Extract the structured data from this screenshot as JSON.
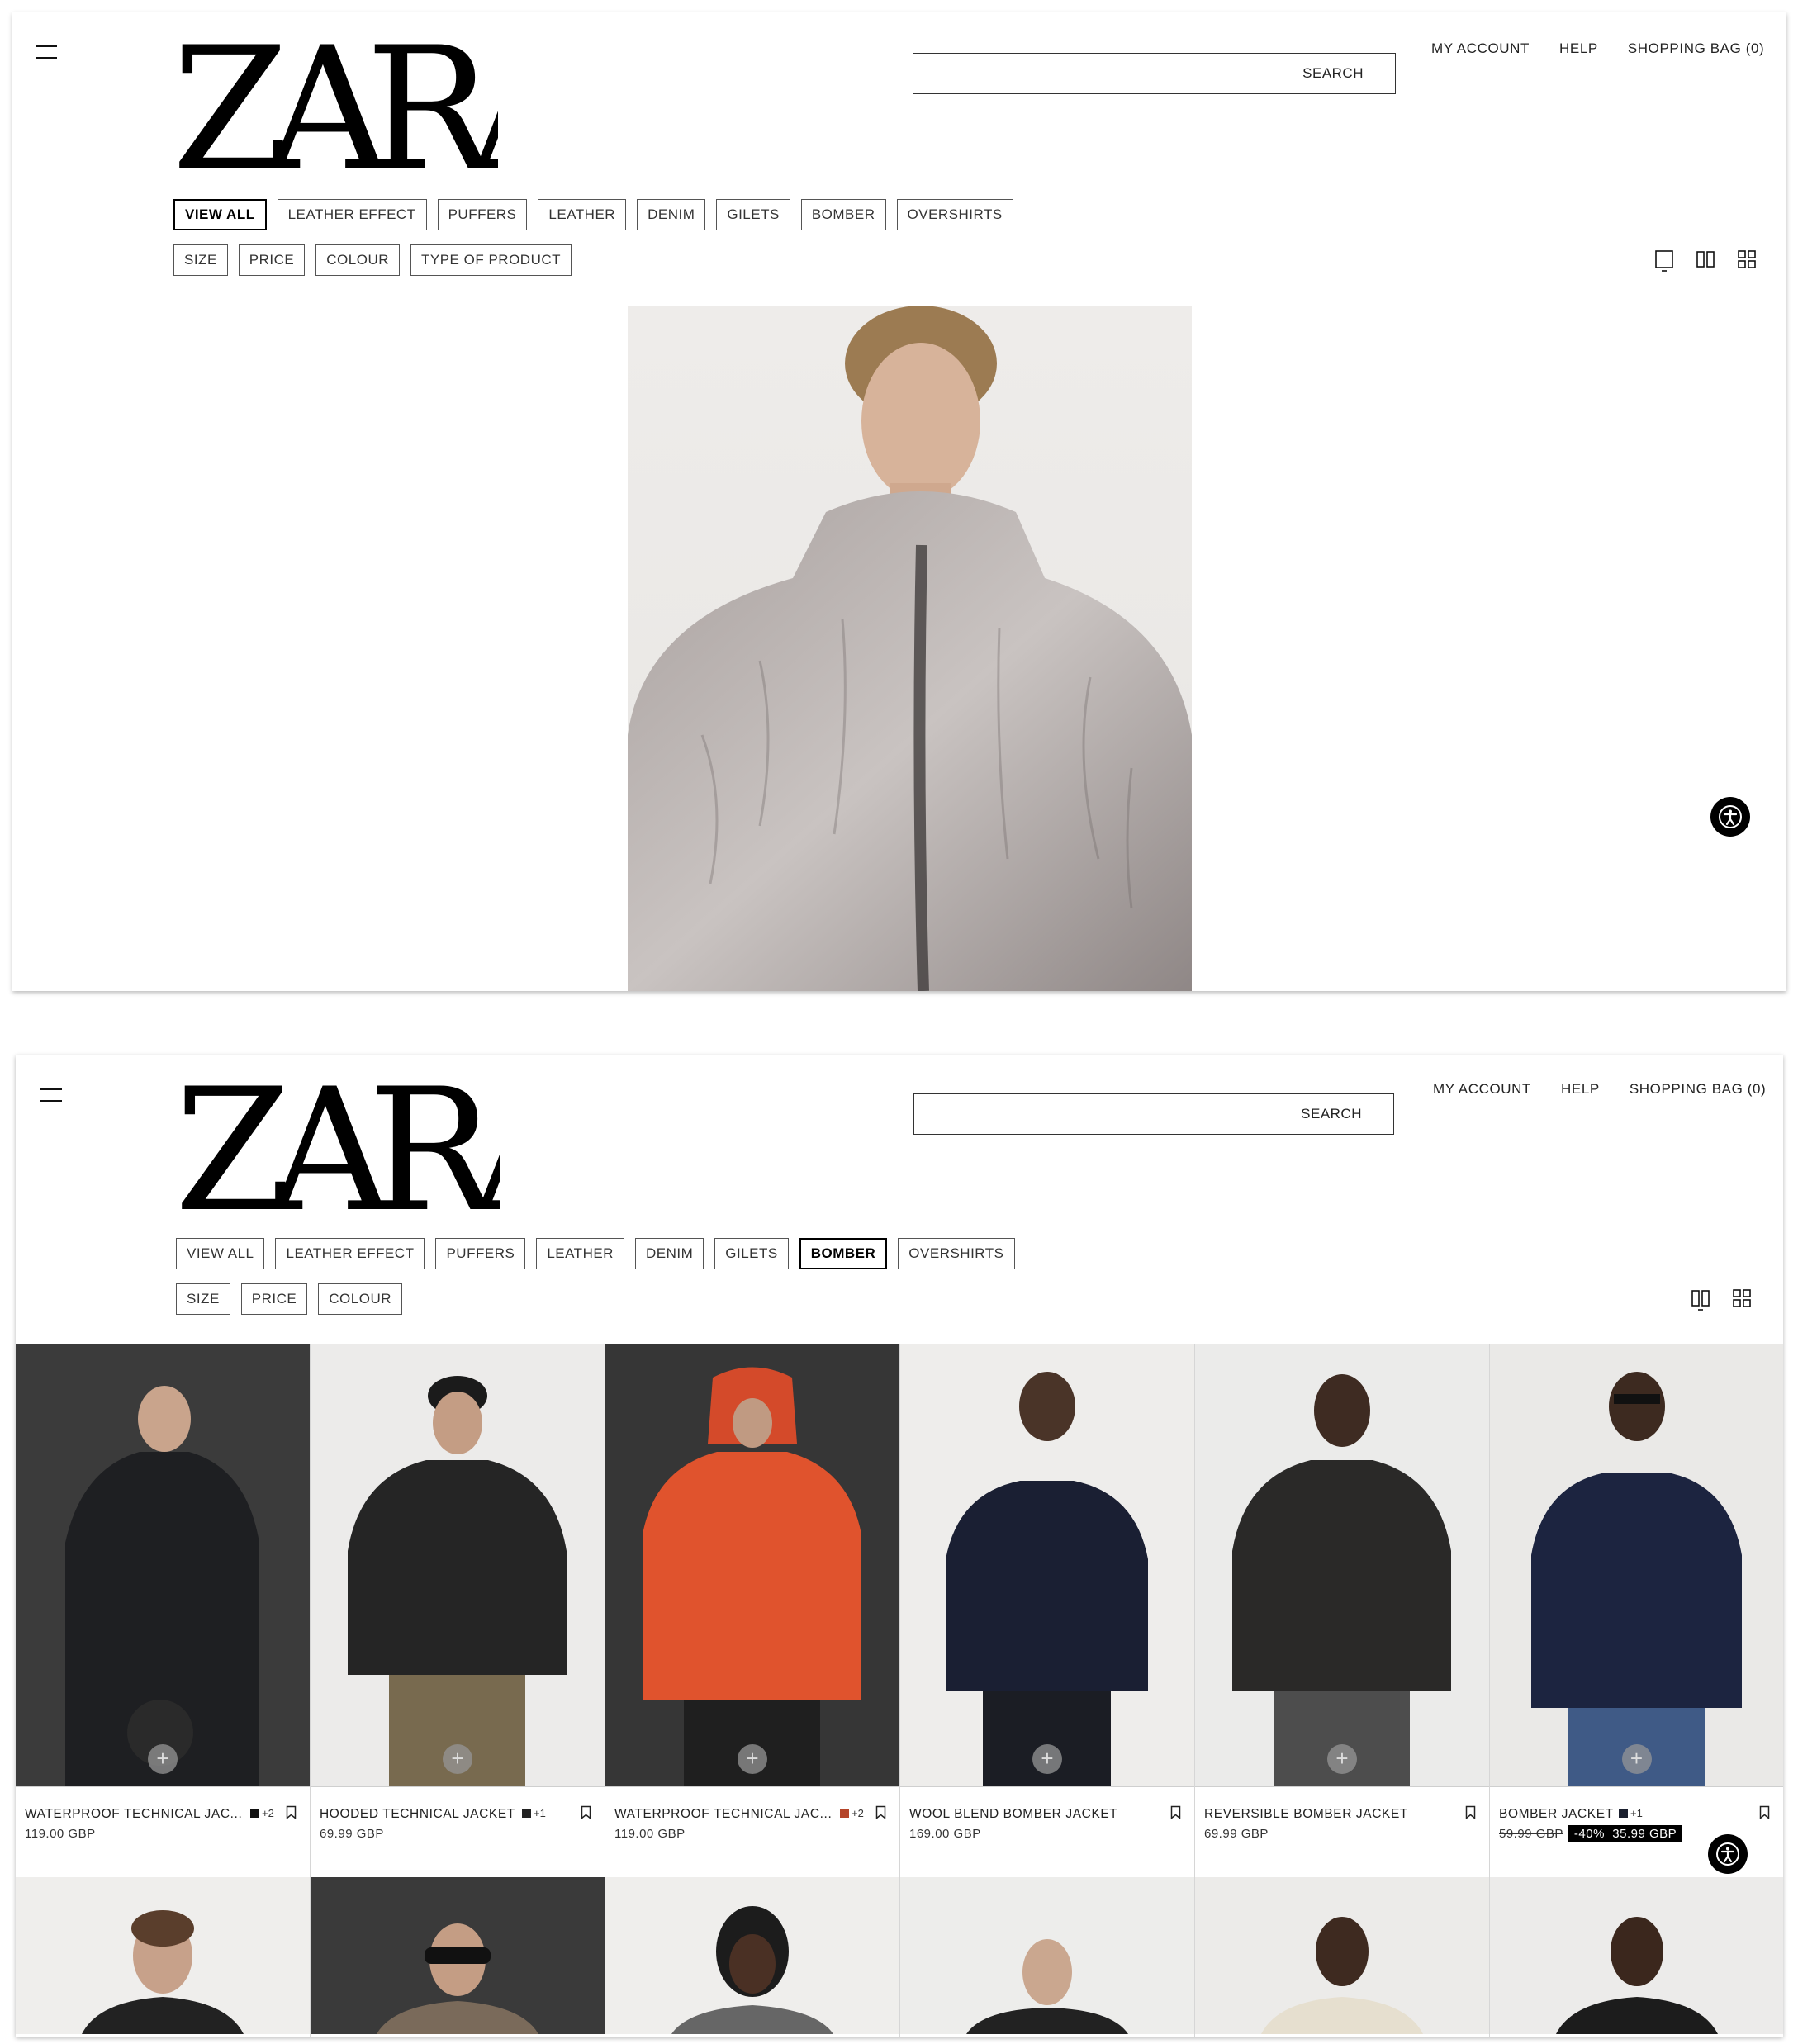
{
  "brand": {
    "logo_text": "ZARA"
  },
  "header": {
    "search_label": "SEARCH",
    "nav": [
      "MY ACCOUNT",
      "HELP",
      "SHOPPING BAG (0)"
    ]
  },
  "panel1": {
    "categories": [
      {
        "label": "VIEW ALL",
        "active": true
      },
      {
        "label": "LEATHER EFFECT",
        "active": false
      },
      {
        "label": "PUFFERS",
        "active": false
      },
      {
        "label": "LEATHER",
        "active": false
      },
      {
        "label": "DENIM",
        "active": false
      },
      {
        "label": "GILETS",
        "active": false
      },
      {
        "label": "BOMBER",
        "active": false
      },
      {
        "label": "OVERSHIRTS",
        "active": false
      }
    ],
    "filters": [
      "SIZE",
      "PRICE",
      "COLOUR",
      "TYPE OF PRODUCT"
    ],
    "view_icons": [
      "single-view-icon",
      "two-column-view-icon",
      "four-grid-view-icon"
    ],
    "hero_image": "faux-fur-hooded-jacket-model"
  },
  "panel2": {
    "categories": [
      {
        "label": "VIEW ALL",
        "active": false
      },
      {
        "label": "LEATHER EFFECT",
        "active": false
      },
      {
        "label": "PUFFERS",
        "active": false
      },
      {
        "label": "LEATHER",
        "active": false
      },
      {
        "label": "DENIM",
        "active": false
      },
      {
        "label": "GILETS",
        "active": false
      },
      {
        "label": "BOMBER",
        "active": true
      },
      {
        "label": "OVERSHIRTS",
        "active": false
      }
    ],
    "filters": [
      "SIZE",
      "PRICE",
      "COLOUR"
    ],
    "view_icons": [
      "two-column-view-icon",
      "four-grid-view-icon"
    ],
    "products": [
      {
        "name": "WATERPROOF TECHNICAL JAC...",
        "price": "119.00 GBP",
        "swatch": "#111111",
        "more": "+2",
        "bg": "#3b3b3b"
      },
      {
        "name": "HOODED TECHNICAL JACKET",
        "price": "69.99 GBP",
        "swatch": "#222222",
        "more": "+1",
        "bg": "#ecebea"
      },
      {
        "name": "WATERPROOF TECHNICAL JAC...",
        "price": "119.00 GBP",
        "swatch": "#b5452a",
        "more": "+2",
        "bg": "#363636"
      },
      {
        "name": "WOOL BLEND BOMBER JACKET",
        "price": "169.00 GBP",
        "swatch": "",
        "more": "",
        "bg": "#eeedeb"
      },
      {
        "name": "REVERSIBLE BOMBER JACKET",
        "price": "69.99 GBP",
        "swatch": "",
        "more": "",
        "bg": "#ebebea"
      },
      {
        "name": "BOMBER JACKET",
        "price_old": "59.99 GBP",
        "discount": "-40%",
        "price": "35.99 GBP",
        "swatch": "#1a1f2e",
        "more": "+1",
        "bg": "#eae9e7"
      }
    ],
    "row2_backgrounds": [
      "#efeeec",
      "#3a3a3a",
      "#efeeec",
      "#ededeb",
      "#ecebe9",
      "#ecebea"
    ]
  },
  "colors": {
    "text": "#111111",
    "border": "#555555",
    "accent": "#000000"
  }
}
